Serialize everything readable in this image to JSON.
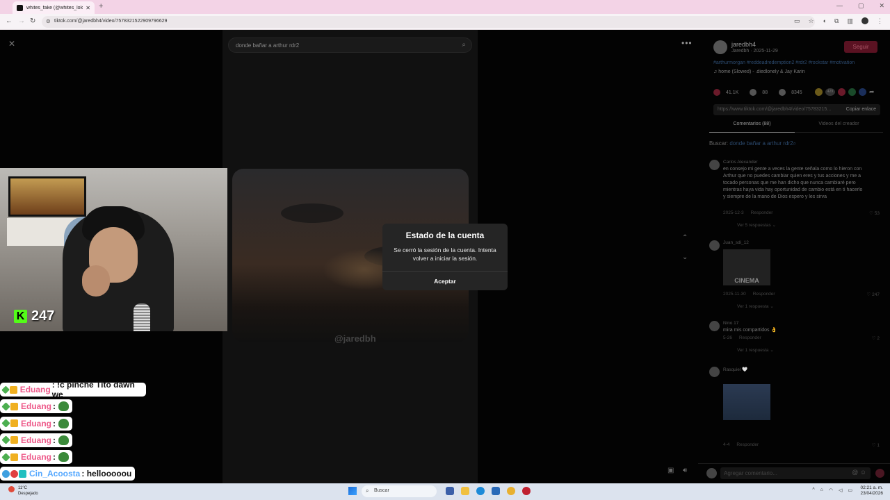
{
  "browser": {
    "tab_title": "whites_fake (@whites_lolo) | Tik",
    "tab_close": "✕",
    "new_tab": "+",
    "url": "tiktok.com/@jaredbh4/video/7578321522909796629"
  },
  "tiktok": {
    "search_query": "donde bañar a arthur rdr2",
    "video_handle": "@jaredbh",
    "author": {
      "name": "jaredbh4",
      "sub": "Jaredbh · 2025-11-29",
      "follow_label": "Seguir",
      "hashtags": "#arthurmorgan #reddeadredemption2 #rdr2 #rockstar #motivation",
      "music": "♫  home (Slowed) - .diedlonely & Jay Karin"
    },
    "stats": {
      "likes": "41.1K",
      "comments": "88",
      "saves": "8345",
      "share_count": "429"
    },
    "link": {
      "url": "https://www.tiktok.com/@jaredbh4/video/75783215...",
      "copy_label": "Copiar enlace"
    },
    "tabs": {
      "comments": "Comentarios (88)",
      "creator_videos": "Videos del creador"
    },
    "search_prefix": "Buscar:",
    "search_query_full": "donde bañar a arthur rdr2",
    "comments": [
      {
        "name": "Carlos Alexander",
        "text": "en consejo mi gente a veces la gente señala como lo hieron con Arthur que no puedes cambiar quien eres y tus acciones y me a tocado personas que me han dicho que nunca cambiaré pero mientras haya vida hay oportunidad de cambio está en ti hacerlo y siempre de la mano de Dios espero y les sirva",
        "date": "2025-12-3",
        "reply": "Responder",
        "likes": "♡ 53",
        "more": "Ver 5 respuestas ⌄"
      },
      {
        "name": "Juan_sdi_12",
        "thumb_text": "CINEMA",
        "date": "2025-11-30",
        "reply": "Responder",
        "likes": "♡ 247",
        "more": "Ver 1 respuesta ⌄"
      },
      {
        "name": "Nino 17",
        "text": "mira mis compartidos 👌",
        "date": "5-26",
        "reply": "Responder",
        "likes": "♡ 2",
        "more": "Ver 1 respuesta ⌄"
      },
      {
        "name": "Rasquiel 🤍",
        "date": "4-4",
        "reply": "Responder",
        "likes": "♡ 1"
      }
    ],
    "comment_placeholder": "Agregar comentario..."
  },
  "modal": {
    "title": "Estado de la cuenta",
    "message": "Se cerró la sesión de la cuenta. Intenta volver a iniciar la sesión.",
    "ok": "Aceptar"
  },
  "stream": {
    "viewer_count": "247",
    "chat": [
      {
        "user": "Eduang",
        "text": ": !c pinche Tito dawn we",
        "emote": false,
        "color": "pink"
      },
      {
        "user": "Eduang",
        "text": ":",
        "emote": true,
        "color": "pink"
      },
      {
        "user": "Eduang",
        "text": ":",
        "emote": true,
        "color": "pink"
      },
      {
        "user": "Eduang",
        "text": ":",
        "emote": true,
        "color": "pink"
      },
      {
        "user": "Eduang",
        "text": ":",
        "emote": true,
        "color": "pink"
      },
      {
        "user": "Cin_Acoosta",
        "text": ": hellooooou",
        "emote": false,
        "color": "blue"
      }
    ]
  },
  "taskbar": {
    "temp": "11°C",
    "weather": "Despejado",
    "search_label": "Buscar",
    "time": "02:21 a. m.",
    "date": "23/04/2026"
  }
}
